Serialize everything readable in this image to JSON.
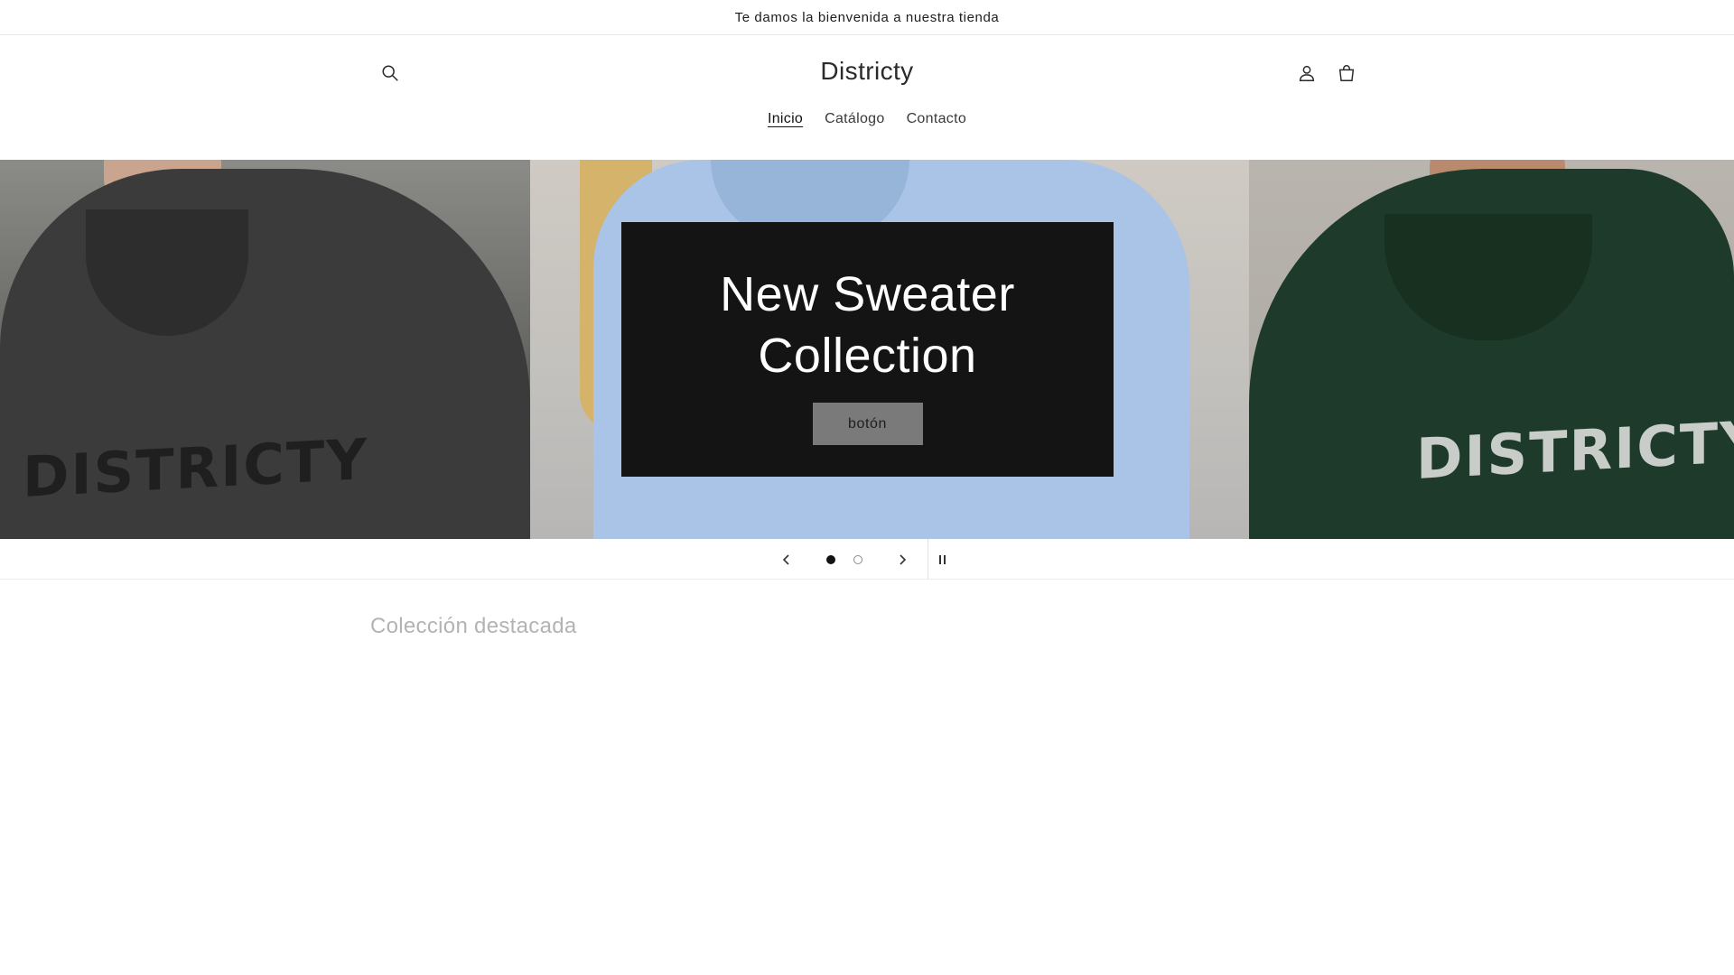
{
  "announcement": {
    "text": "Te damos la bienvenida a nuestra tienda"
  },
  "header": {
    "brand": "Districty",
    "nav": [
      {
        "label": "Inicio",
        "active": true
      },
      {
        "label": "Catálogo",
        "active": false
      },
      {
        "label": "Contacto",
        "active": false
      }
    ],
    "icons": {
      "search": "search-icon",
      "account": "user-icon",
      "cart": "cart-icon"
    }
  },
  "hero": {
    "title_line1": "New Sweater",
    "title_line2": "Collection",
    "button_label": "botón",
    "hoodie_print": "DISTRICTY",
    "colors": {
      "hoodie_left": "#3a3a3a",
      "hoodie_mid": "#a8c4e6",
      "hoodie_right": "#1f3a2a",
      "overlay": "#141414"
    }
  },
  "slider": {
    "slides_count": 2,
    "active_slide": 1,
    "icons": {
      "prev": "chevron-left-icon",
      "next": "chevron-right-icon",
      "pause": "pause-icon"
    }
  },
  "featured": {
    "heading": "Colección destacada"
  }
}
